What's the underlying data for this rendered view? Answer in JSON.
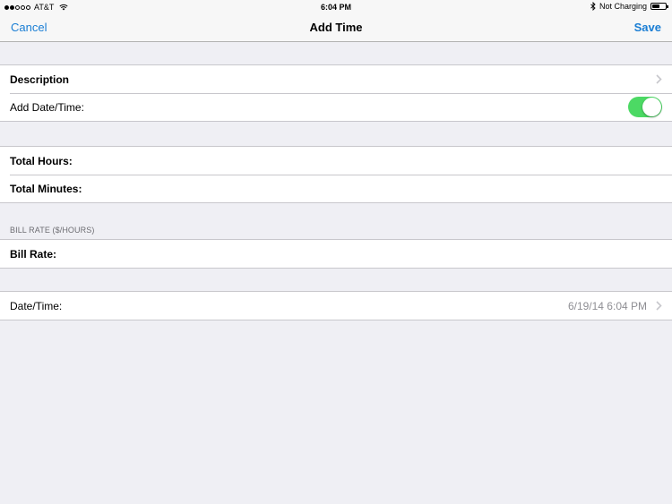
{
  "status_bar": {
    "carrier": "AT&T",
    "time": "6:04 PM",
    "charging": "Not Charging",
    "battery_level": 0.6,
    "signal_bars_filled": 2,
    "signal_bars_total": 5
  },
  "nav": {
    "cancel_label": "Cancel",
    "title": "Add Time",
    "save_label": "Save"
  },
  "sections": {
    "general": {
      "description_label": "Description",
      "add_datetime_label": "Add Date/Time:",
      "add_datetime_on": true
    },
    "duration": {
      "hours_label": "Total Hours:",
      "minutes_label": "Total Minutes:"
    },
    "billing": {
      "header": "BILL RATE ($/HOURS)",
      "rate_label": "Bill Rate:"
    },
    "datetime": {
      "label": "Date/Time:",
      "value": "6/19/14 6:04 PM"
    }
  },
  "colors": {
    "tint": "#1a7ed4",
    "toggle_on": "#4cd964",
    "background": "#efeff4",
    "separator": "#c8c7cc",
    "secondary_text": "#8e8e93"
  }
}
